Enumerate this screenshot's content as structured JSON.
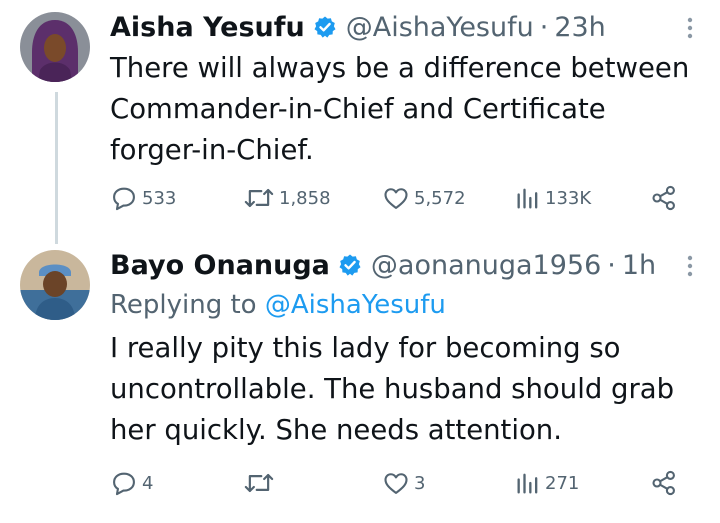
{
  "tweets": [
    {
      "author_name": "Aisha Yesufu",
      "handle": "@AishaYesufu",
      "separator": "·",
      "time": "23h",
      "text": "There will always be a difference between\nCommander-in-Chief and Certificate\nforger-in-Chief.",
      "reply_count": "533",
      "retweet_count": "1,858",
      "like_count": "5,572",
      "view_count": "133K",
      "avatar_icon": "avatar-hijab-woman",
      "verified": true
    },
    {
      "author_name": "Bayo Onanuga",
      "handle": "@aonanuga1956",
      "separator": "·",
      "time": "1h",
      "replying_prefix": "Replying to",
      "replying_handle": "@AishaYesufu",
      "text": "I really pity this lady for becoming so\nuncontrollable. The husband should grab\nher quickly. She needs attention.",
      "reply_count": "4",
      "retweet_count": "",
      "like_count": "3",
      "view_count": "271",
      "avatar_icon": "avatar-man-cap",
      "verified": true
    }
  ],
  "colors": {
    "text_primary": "#0f1419",
    "text_secondary": "#536471",
    "accent": "#1d9bf0",
    "thread_line": "#cfd9de"
  },
  "icons": [
    "verified-badge-icon",
    "more-options-icon",
    "reply-icon",
    "retweet-icon",
    "like-icon",
    "views-icon",
    "share-icon"
  ]
}
